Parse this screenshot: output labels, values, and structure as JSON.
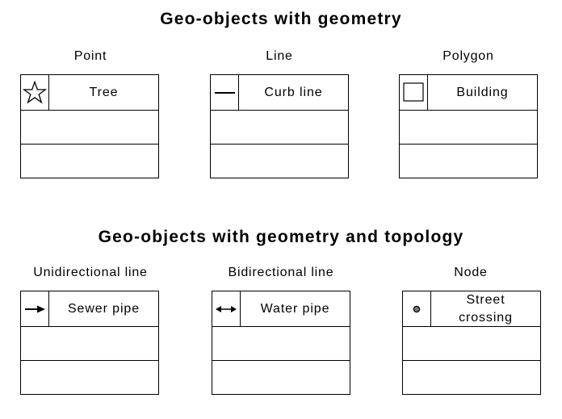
{
  "sections": [
    {
      "title": "Geo-objects with geometry",
      "items": [
        {
          "caption": "Point",
          "name": "Tree",
          "icon": "star-icon"
        },
        {
          "caption": "Line",
          "name": "Curb line",
          "icon": "line-icon"
        },
        {
          "caption": "Polygon",
          "name": "Building",
          "icon": "square-icon"
        }
      ]
    },
    {
      "title": "Geo-objects with geometry and topology",
      "items": [
        {
          "caption": "Unidirectional line",
          "name": "Sewer pipe",
          "icon": "arrow-right-icon"
        },
        {
          "caption": "Bidirectional line",
          "name": "Water pipe",
          "icon": "double-arrow-icon"
        },
        {
          "caption": "Node",
          "name": "Street\ncrossing",
          "icon": "node-dot-icon"
        }
      ]
    }
  ]
}
